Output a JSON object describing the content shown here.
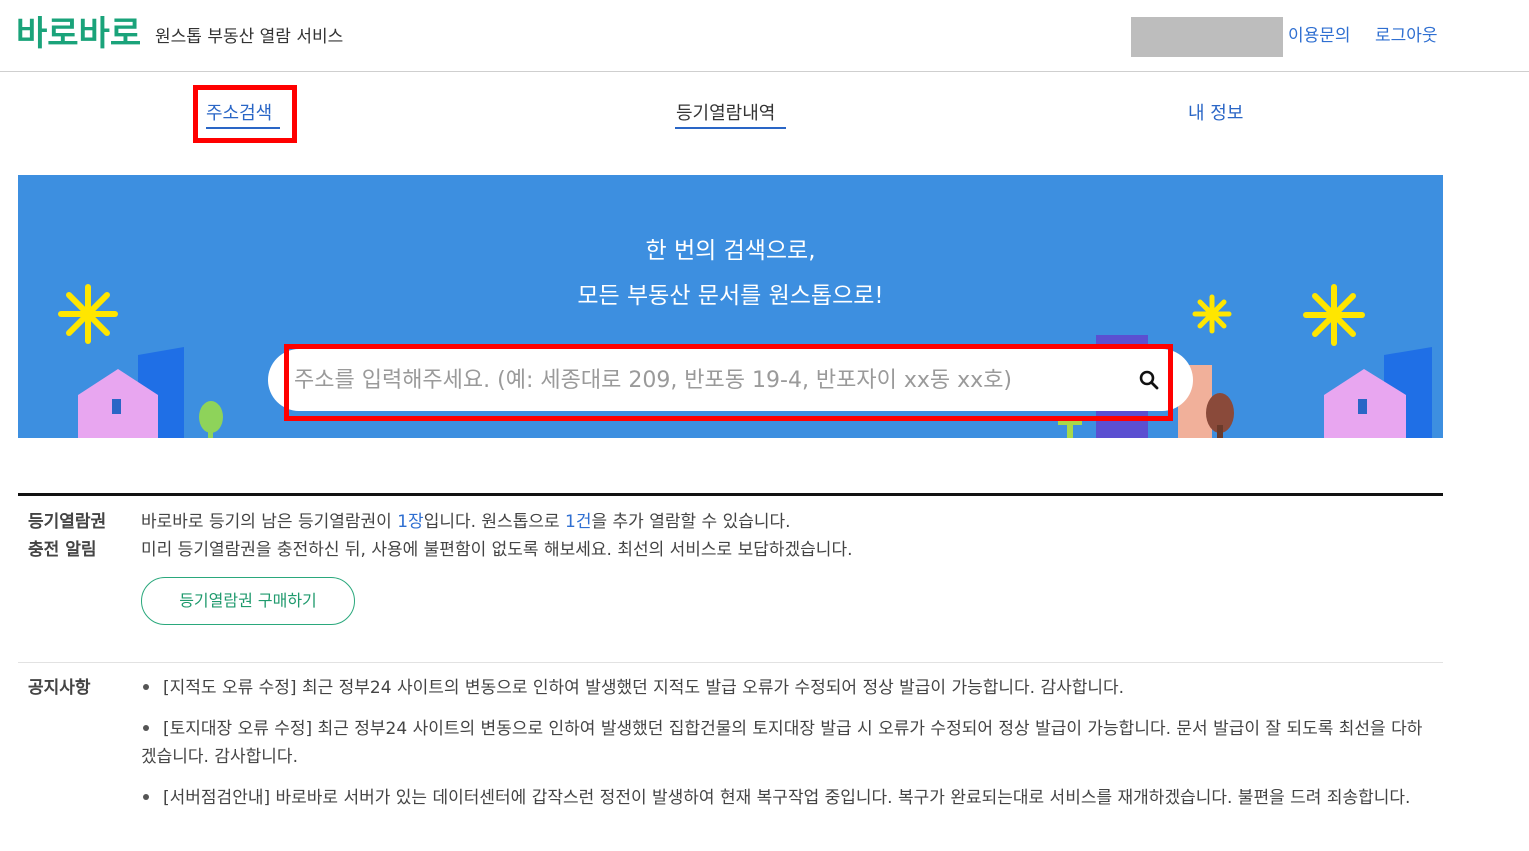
{
  "header": {
    "logo": "바로바로",
    "subtitle": "원스톱 부동산 열람 서비스",
    "links": [
      "이용문의",
      "로그아웃"
    ]
  },
  "tabs": [
    {
      "label": "주소검색",
      "active": true
    },
    {
      "label": "등기열람내역",
      "active": false
    },
    {
      "label": "내 정보",
      "active": false
    }
  ],
  "banner": {
    "line1": "한 번의 검색으로,",
    "line2": "모든 부동산 문서를 원스톱으로!",
    "bg_color": "#3d8fe0"
  },
  "search": {
    "placeholder": "주소를 입력해주세요. (예: 세종대로 209, 반포동 19-4, 반포자이 xx동 xx호)",
    "value": "",
    "icon": "search-icon"
  },
  "recharge": {
    "label_line1": "등기열람권",
    "label_line2": "충전 알림",
    "text1_a": "바로바로 등기의 남은 등기열람권이 ",
    "text1_count": "1장",
    "text1_b": "입니다. 원스톱으로 ",
    "text1_count2": "1건",
    "text1_c": "을 추가 열람할 수 있습니다.",
    "text2": "미리 등기열람권을 충전하신 뒤, 사용에 불편함이 없도록 해보세요. 최선의 서비스로 보답하겠습니다.",
    "button": "등기열람권 구매하기"
  },
  "notices": {
    "label": "공지사항",
    "items": [
      "[지적도 오류 수정] 최근 정부24 사이트의 변동으로 인하여 발생했던 지적도 발급 오류가 수정되어 정상 발급이 가능합니다. 감사합니다.",
      "[토지대장 오류 수정] 최근 정부24 사이트의 변동으로 인하여 발생했던 집합건물의 토지대장 발급 시 오류가 수정되어 정상 발급이 가능합니다. 문서 발급이 잘 되도록 최선을 다하겠습니다. 감사합니다.",
      "[서버점검안내] 바로바로 서버가 있는 데이터센터에 갑작스런 정전이 발생하여 현재 복구작업 중입니다. 복구가 완료되는대로 서비스를 재개하겠습니다. 불편을 드려 죄송합니다."
    ]
  },
  "colors": {
    "brand": "#1aa37a",
    "link": "#2f6fd1",
    "highlight": "#ff0000"
  }
}
